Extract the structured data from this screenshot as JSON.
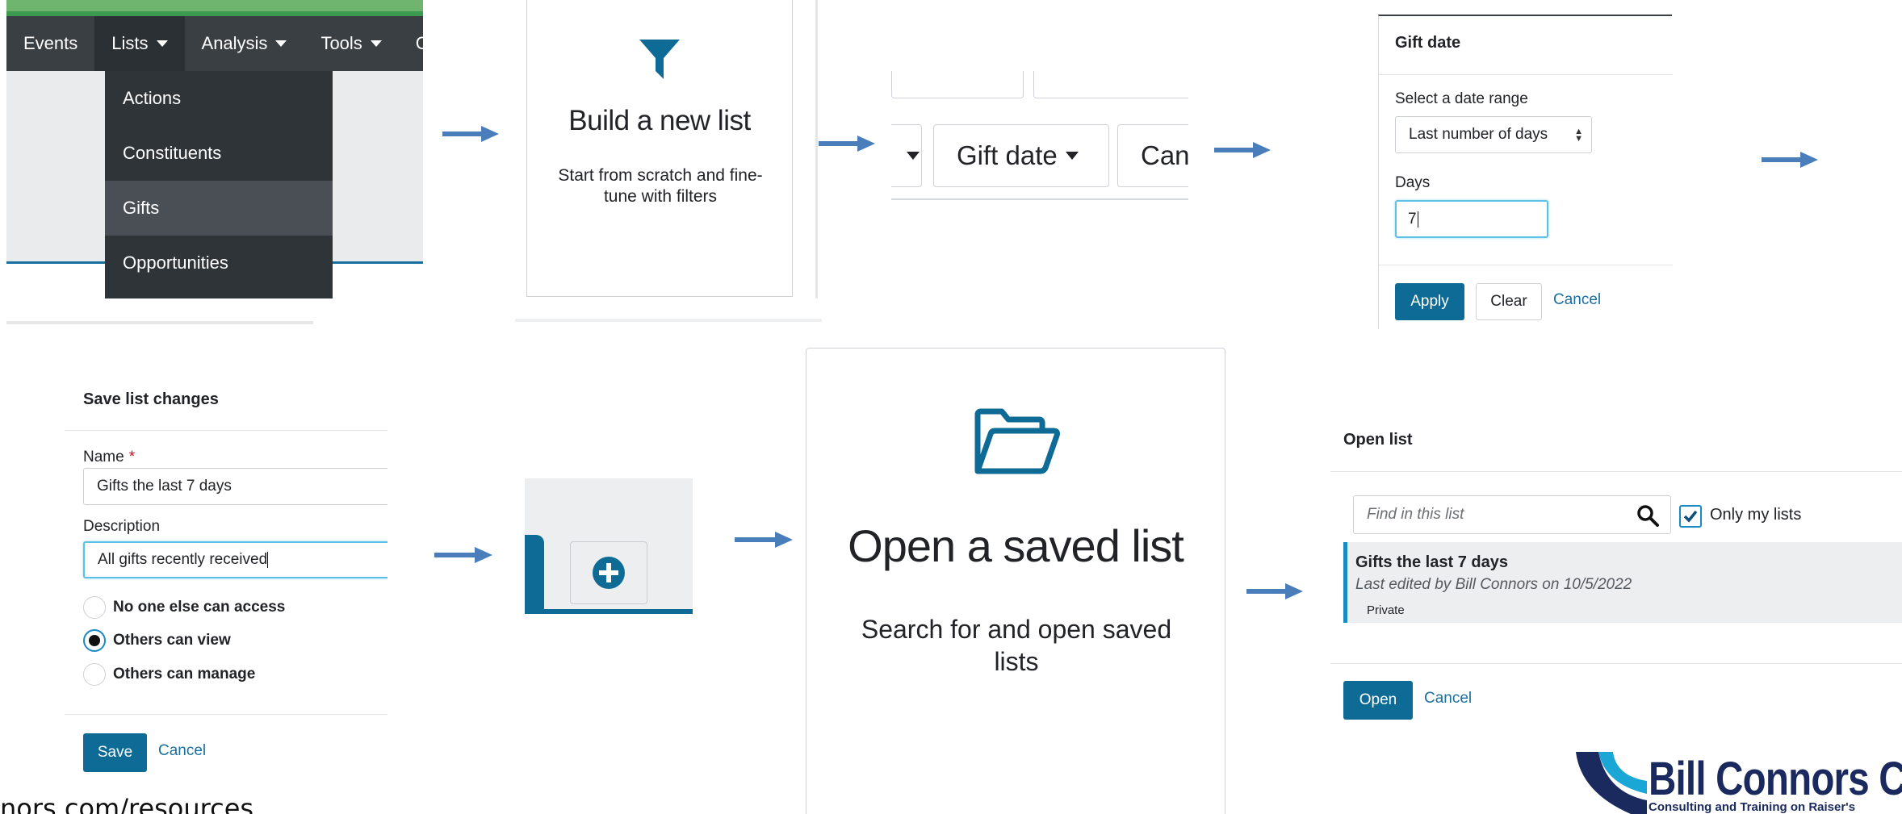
{
  "nav": {
    "items": [
      "Events",
      "Lists",
      "Analysis",
      "Tools",
      "C"
    ],
    "dropdown": [
      "Actions",
      "Constituents",
      "Gifts",
      "Opportunities"
    ],
    "highlighted": "Gifts"
  },
  "build": {
    "icon": "filter-icon",
    "title": "Build a new list",
    "subtitle": "Start from scratch and fine-tune with filters"
  },
  "filters": {
    "gift_date": "Gift date",
    "campaign_partial": "Can"
  },
  "gift_panel": {
    "title": "Gift date",
    "range_label": "Select a date range",
    "range_value": "Last number of days",
    "days_label": "Days",
    "days_value": "7",
    "apply": "Apply",
    "clear": "Clear",
    "cancel": "Cancel"
  },
  "save_panel": {
    "title": "Save list changes",
    "name_label": "Name",
    "required_mark": "*",
    "name_value": "Gifts the last 7 days",
    "description_label": "Description",
    "description_value": "All gifts recently received",
    "options": [
      "No one else can access",
      "Others can view",
      "Others can manage"
    ],
    "selected_option": "Others can view",
    "save": "Save",
    "cancel": "Cancel"
  },
  "add_button": {
    "icon": "plus-circle-icon"
  },
  "open_card": {
    "icon": "folder-open-icon",
    "title": "Open a saved list",
    "subtitle": "Search for and open saved lists"
  },
  "open_list": {
    "title": "Open list",
    "search_placeholder": "Find in this list",
    "only_mine_label": "Only my lists",
    "only_mine_checked": true,
    "row_name": "Gifts the last 7 days",
    "row_meta": "Last edited by Bill Connors on 10/5/2022",
    "row_badge": "Private",
    "open": "Open",
    "cancel": "Cancel"
  },
  "logo": {
    "text": "Bill Connors CF",
    "tagline": "Consulting and Training on Raiser's"
  },
  "footer": {
    "url_partial": "nors.com/resources"
  },
  "colors": {
    "primary": "#0d6b96",
    "link": "#1a6ea0",
    "nav_dark": "#3a3f44",
    "arrow": "#4a7ebb",
    "focus": "#5cc1e6"
  }
}
